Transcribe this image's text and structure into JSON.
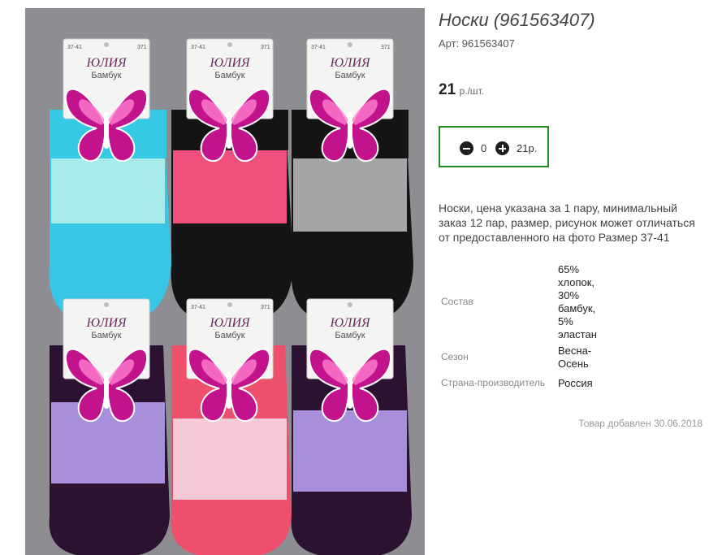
{
  "product": {
    "title": "Носки (961563407)",
    "sku": "Арт: 961563407",
    "price": {
      "amount": "21",
      "unit": "р./шт."
    },
    "cart": {
      "quantity": "0",
      "total": "21р."
    },
    "description": "Носки, цена указана за 1 пару, минимальный заказ 12 пар, размер, рисунок может отличаться от предоставленного на фото Размер 37-41",
    "properties": [
      {
        "label": "Состав",
        "value": "65% хлопок, 30% бамбук, 5% эластан"
      },
      {
        "label": "Сезон",
        "value": "Весна-Осень"
      },
      {
        "label": "Страна-производитель",
        "value": "Россия"
      }
    ],
    "added": "Товар добавлен 30.06.2018"
  },
  "photo": {
    "tag_size": "37-41",
    "tag_code": "371",
    "brand": "ЮЛИЯ",
    "material": "Бамбук"
  },
  "colors": {
    "accent_border": "#1f8a1f",
    "photo_background": "#8e8e92"
  },
  "icons": {
    "minus": "minus-circle-icon",
    "plus": "plus-circle-icon"
  }
}
